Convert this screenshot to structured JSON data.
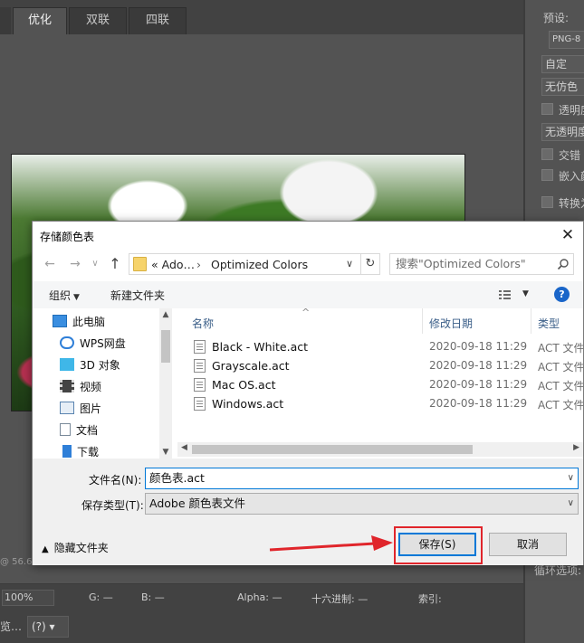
{
  "ps": {
    "tabs": [
      "优化",
      "双联",
      "四联"
    ],
    "right_panel": {
      "preset_label": "预设:",
      "format": "PNG-8",
      "reduction": "自定",
      "dither": "无仿色",
      "transparency_label": "透明度",
      "matte": "无透明度",
      "interlaced_label": "交错",
      "embed_label": "嵌入颜",
      "convert_label": "转换为",
      "loop_label": "循环选项:"
    },
    "status": {
      "zoom_hint": "@ 56.6"
    },
    "bottom_bar": {
      "zoom": "100%",
      "g_label": "G: —",
      "b_label": "B: —",
      "alpha_label": "Alpha: —",
      "hex_label": "十六进制: —",
      "index_label": "索引:"
    },
    "footer": {
      "left_text": "览…",
      "help_icon": "question-icon"
    }
  },
  "dialog": {
    "title": "存储颜色表",
    "close_icon": "close-icon",
    "address": {
      "crumb1": "«  Ado…",
      "crumb2": "Optimized Colors"
    },
    "search_placeholder": "搜索\"Optimized Colors\"",
    "toolbar": {
      "organize": "组织",
      "new_folder": "新建文件夹"
    },
    "nav_items": [
      "此电脑",
      "WPS网盘",
      "3D 对象",
      "视频",
      "图片",
      "文档",
      "下载"
    ],
    "columns": {
      "name": "名称",
      "date": "修改日期",
      "type": "类型"
    },
    "files": [
      {
        "name": "Black - White.act",
        "date": "2020-09-18 11:29",
        "type": "ACT 文件"
      },
      {
        "name": "Grayscale.act",
        "date": "2020-09-18 11:29",
        "type": "ACT 文件"
      },
      {
        "name": "Mac OS.act",
        "date": "2020-09-18 11:29",
        "type": "ACT 文件"
      },
      {
        "name": "Windows.act",
        "date": "2020-09-18 11:29",
        "type": "ACT 文件"
      }
    ],
    "filename_label": "文件名(N):",
    "filename_value": "颜色表.act",
    "filetype_label": "保存类型(T):",
    "filetype_value": "Adobe 颜色表文件",
    "hide_folders": "隐藏文件夹",
    "save_button": "保存(S)",
    "cancel_button": "取消"
  },
  "colors": {
    "accent": "#0078d7",
    "highlight_red": "#e0252b",
    "ps_bg": "#535353"
  }
}
